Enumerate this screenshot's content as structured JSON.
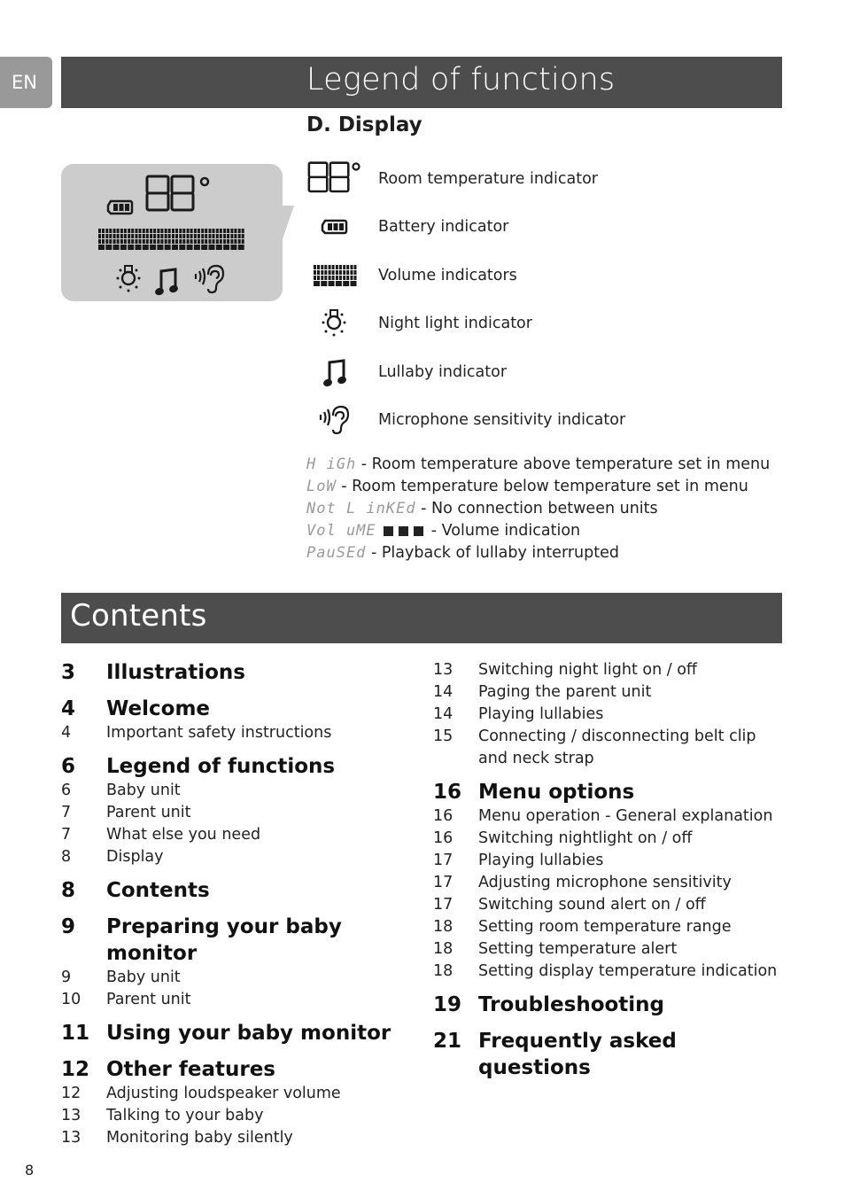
{
  "language_tab": "EN",
  "legend": {
    "title": "Legend of functions",
    "section": "D. Display",
    "indicators": [
      {
        "icon": "temperature-digits-icon",
        "label": "Room temperature indicator"
      },
      {
        "icon": "battery-icon",
        "label": "Battery indicator"
      },
      {
        "icon": "volume-bars-icon",
        "label": "Volume indicators"
      },
      {
        "icon": "night-light-icon",
        "label": "Night light indicator"
      },
      {
        "icon": "music-note-icon",
        "label": "Lullaby indicator"
      },
      {
        "icon": "ear-sound-icon",
        "label": "Microphone sensitivity indicator"
      }
    ],
    "lcd_preview": {
      "temperature": "88",
      "degree": "°"
    },
    "display_messages": [
      {
        "lcd": "H iGh",
        "text": " - Room temperature above temperature set in menu"
      },
      {
        "lcd": "LoW",
        "text": " - Room temperature below temperature set in menu"
      },
      {
        "lcd": "Not L inKEd",
        "text": " - No connection between units"
      },
      {
        "lcd": "Vol uME",
        "squares": 3,
        "text": " - Volume indication"
      },
      {
        "lcd": "PauSEd",
        "text": " - Playback of lullaby interrupted"
      }
    ]
  },
  "contents": {
    "title": "Contents",
    "left_column": [
      {
        "num": "3",
        "label": "Illustrations",
        "heading": true
      },
      {
        "num": "4",
        "label": "Welcome",
        "heading": true
      },
      {
        "num": "4",
        "label": "Important safety instructions",
        "heading": false
      },
      {
        "num": "6",
        "label": "Legend of functions",
        "heading": true
      },
      {
        "num": "6",
        "label": "Baby unit",
        "heading": false
      },
      {
        "num": "7",
        "label": "Parent unit",
        "heading": false
      },
      {
        "num": "7",
        "label": "What else you need",
        "heading": false
      },
      {
        "num": "8",
        "label": "Display",
        "heading": false
      },
      {
        "num": "8",
        "label": "Contents",
        "heading": true
      },
      {
        "num": "9",
        "label": "Preparing your baby monitor",
        "heading": true
      },
      {
        "num": "9",
        "label": "Baby unit",
        "heading": false
      },
      {
        "num": "10",
        "label": "Parent unit",
        "heading": false
      },
      {
        "num": "11",
        "label": "Using your baby monitor",
        "heading": true
      },
      {
        "num": "12",
        "label": "Other features",
        "heading": true
      },
      {
        "num": "12",
        "label": "Adjusting loudspeaker volume",
        "heading": false
      },
      {
        "num": "13",
        "label": "Talking to your baby",
        "heading": false
      },
      {
        "num": "13",
        "label": "Monitoring baby silently",
        "heading": false
      }
    ],
    "right_column": [
      {
        "num": "13",
        "label": "Switching night light on / off",
        "heading": false
      },
      {
        "num": "14",
        "label": "Paging the parent unit",
        "heading": false
      },
      {
        "num": "14",
        "label": "Playing lullabies",
        "heading": false
      },
      {
        "num": "15",
        "label": "Connecting / disconnecting belt clip and neck strap",
        "heading": false
      },
      {
        "num": "16",
        "label": "Menu options",
        "heading": true
      },
      {
        "num": "16",
        "label": "Menu operation - General explanation",
        "heading": false
      },
      {
        "num": "16",
        "label": "Switching nightlight on / off",
        "heading": false
      },
      {
        "num": "17",
        "label": "Playing lullabies",
        "heading": false
      },
      {
        "num": "17",
        "label": "Adjusting microphone sensitivity",
        "heading": false
      },
      {
        "num": "17",
        "label": "Switching sound alert on / off",
        "heading": false
      },
      {
        "num": "18",
        "label": "Setting room temperature range",
        "heading": false
      },
      {
        "num": "18",
        "label": "Setting temperature alert",
        "heading": false
      },
      {
        "num": "18",
        "label": "Setting display temperature indication",
        "heading": false
      },
      {
        "num": "19",
        "label": "Troubleshooting",
        "heading": true
      },
      {
        "num": "21",
        "label": "Frequently asked questions",
        "heading": true
      }
    ]
  },
  "page_number": "8",
  "colors": {
    "header_bar": "#4d4d4d",
    "language_tab": "#999999",
    "lcd_background": "#cccccc",
    "lcd_text": "#9a9a9a"
  }
}
